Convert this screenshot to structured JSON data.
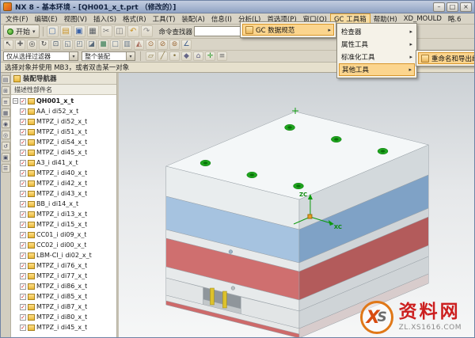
{
  "titlebar": {
    "title": "NX 8 - 基本环境 - [QH001_x_t.prt （修改的）]",
    "minimize": "–",
    "maximize": "□",
    "close": "×"
  },
  "menubar": {
    "items": [
      {
        "label": "文件(F)"
      },
      {
        "label": "编辑(E)"
      },
      {
        "label": "视图(V)"
      },
      {
        "label": "插入(S)"
      },
      {
        "label": "格式(R)"
      },
      {
        "label": "工具(T)"
      },
      {
        "label": "装配(A)"
      },
      {
        "label": "信息(I)"
      },
      {
        "label": "分析(L)"
      },
      {
        "label": "首选项(P)"
      },
      {
        "label": "窗口(O)"
      },
      {
        "label": "GC 工具箱",
        "selected": true
      },
      {
        "label": "帮助(H)"
      },
      {
        "label": "XD_MOULD"
      },
      {
        "label": "略.6"
      }
    ]
  },
  "toolbar_top": {
    "start_label": "开始",
    "command_finder_label": "命令查找器",
    "icons": [
      {
        "name": "new-file-icon",
        "glyph": "▢",
        "color": "#4a6fa5"
      },
      {
        "name": "open-icon",
        "glyph": "▤",
        "color": "#c9952c"
      },
      {
        "name": "save-icon",
        "glyph": "▣",
        "color": "#3a62a8"
      },
      {
        "name": "print-icon",
        "glyph": "▦",
        "color": "#5a5f66"
      },
      {
        "name": "cut-icon",
        "glyph": "✂",
        "color": "#777777"
      },
      {
        "name": "copy-icon",
        "glyph": "◫",
        "color": "#777777"
      },
      {
        "name": "undo-icon",
        "glyph": "↶",
        "color": "#c9952c"
      },
      {
        "name": "redo-icon",
        "glyph": "↷",
        "color": "#8a8a8a"
      }
    ],
    "icons_right": [
      {
        "name": "binoculars-icon",
        "glyph": "◉",
        "color": "#44485a"
      },
      {
        "name": "window-layout-icon",
        "glyph": "◧",
        "color": "#55617a"
      },
      {
        "name": "view-split-icon",
        "glyph": "◨",
        "color": "#55617a"
      },
      {
        "name": "datum-icon",
        "glyph": "✛",
        "color": "#2a9a5a"
      },
      {
        "name": "solid-cube-icon",
        "glyph": "◆",
        "color": "#3a86c8"
      },
      {
        "name": "feature-icon",
        "glyph": "▲",
        "color": "#b8742a"
      }
    ]
  },
  "toolbar_view": {
    "icons": [
      {
        "name": "select-arrow-icon",
        "glyph": "↖",
        "color": "#333333"
      },
      {
        "name": "pan-icon",
        "glyph": "✚",
        "color": "#666666"
      },
      {
        "name": "zoom-icon",
        "glyph": "◎",
        "color": "#444444"
      },
      {
        "name": "rotate-icon",
        "glyph": "↻",
        "color": "#444444"
      },
      {
        "name": "fit-view-icon",
        "glyph": "⊡",
        "color": "#445566"
      },
      {
        "name": "front-view-icon",
        "glyph": "◱",
        "color": "#5a6a7a"
      },
      {
        "name": "top-view-icon",
        "glyph": "◰",
        "color": "#5a6a7a"
      },
      {
        "name": "iso-view-icon",
        "glyph": "◪",
        "color": "#5a6a7a"
      },
      {
        "name": "shaded-view-icon",
        "glyph": "■",
        "color": "#6a9a7a"
      },
      {
        "name": "wireframe-view-icon",
        "glyph": "□",
        "color": "#667788"
      },
      {
        "name": "edges-view-icon",
        "glyph": "▥",
        "color": "#667788"
      },
      {
        "name": "section-view-icon",
        "glyph": "◭",
        "color": "#a86a5a"
      },
      {
        "name": "snap-point-icon",
        "glyph": "⊙",
        "color": "#996633"
      },
      {
        "name": "snap-mid-icon",
        "glyph": "⊘",
        "color": "#996633"
      },
      {
        "name": "snap-end-icon",
        "glyph": "⊚",
        "color": "#996633"
      },
      {
        "name": "measure-icon",
        "glyph": "∠",
        "color": "#3a5a8a"
      }
    ]
  },
  "filter_bar": {
    "selection_filter_value": "仅从选择过滤器",
    "scope_value": "整个装配",
    "icons": [
      {
        "name": "face-filter-icon",
        "glyph": "▱",
        "color": "#887744"
      },
      {
        "name": "edge-filter-icon",
        "glyph": "╱",
        "color": "#887744"
      },
      {
        "name": "vertex-filter-icon",
        "glyph": "•",
        "color": "#887744"
      },
      {
        "name": "body-filter-icon",
        "glyph": "◆",
        "color": "#666688"
      },
      {
        "name": "component-filter-icon",
        "glyph": "⌂",
        "color": "#666688"
      },
      {
        "name": "wcs-icon",
        "glyph": "✛",
        "color": "#2a9a2a"
      },
      {
        "name": "layer-icon",
        "glyph": "≡",
        "color": "#666666"
      }
    ]
  },
  "prompt": {
    "text": "选择对象并使用 MB3，或者双击某一对象"
  },
  "resource_tabs": [
    {
      "name": "assembly-navigator-tab",
      "glyph": "▤"
    },
    {
      "name": "constraint-navigator-tab",
      "glyph": "⊞"
    },
    {
      "name": "part-navigator-tab",
      "glyph": "≡"
    },
    {
      "name": "reuse-library-tab",
      "glyph": "▦"
    },
    {
      "name": "hd3d-tools-tab",
      "glyph": "◉"
    },
    {
      "name": "web-browser-tab",
      "glyph": "◎"
    },
    {
      "name": "history-tab",
      "glyph": "↺"
    },
    {
      "name": "system-materials-tab",
      "glyph": "▣"
    },
    {
      "name": "roles-tab",
      "glyph": "☰"
    }
  ],
  "navigator": {
    "title": "装配导航器",
    "column_header": "描述性部件名",
    "root_label": "QH001_x_t",
    "items": [
      "AA_i di52_x_t",
      "MTPZ_i di52_x_t",
      "MTPZ_i di51_x_t",
      "MTPZ_i di54_x_t",
      "MTPZ_i di45_x_t",
      "A3_i di41_x_t",
      "MTPZ_i di40_x_t",
      "MTPZ_i di42_x_t",
      "MTPZ_i di43_x_t",
      "BB_i di14_x_t",
      "MTPZ_i di13_x_t",
      "MTPZ_i di15_x_t",
      "CC01_i di09_x_t",
      "CC02_i di00_x_t",
      "LBM-CI_i di02_x_t",
      "MTPZ_i di76_x_t",
      "MTPZ_i di77_x_t",
      "MTPZ_i di86_x_t",
      "MTPZ_i di85_x_t",
      "MTPZ_i di87_x_t",
      "MTPZ_i di80_x_t",
      "MTPZ_i di45_x_t"
    ]
  },
  "menus": {
    "level1_item": "GC 数据规范",
    "level2_items": [
      {
        "name": "menu-item-inspector",
        "label": "检查器"
      },
      {
        "name": "menu-item-property-tools",
        "label": "属性工具"
      },
      {
        "name": "menu-item-standardization-tools",
        "label": "标准化工具"
      },
      {
        "name": "menu-item-other-tools",
        "label": "其他工具",
        "selected": true
      }
    ],
    "level3_item": "重命名和导出组件"
  },
  "viewport": {
    "axis_z_label": "ZC",
    "axis_x_label": "XC",
    "colors": {
      "top_plate": "#f4f7f8",
      "a_plate_blue": "#a6c3e0",
      "spacer_red": "#cf6f6f",
      "screw_cap_green": "#1fa41f",
      "pin_yellow": "#ddc22c"
    }
  },
  "watermark": {
    "logo_text_x": "X",
    "logo_text_s": "S",
    "site_name": "资料网",
    "site_url": "ZL.XS1616.COM"
  }
}
